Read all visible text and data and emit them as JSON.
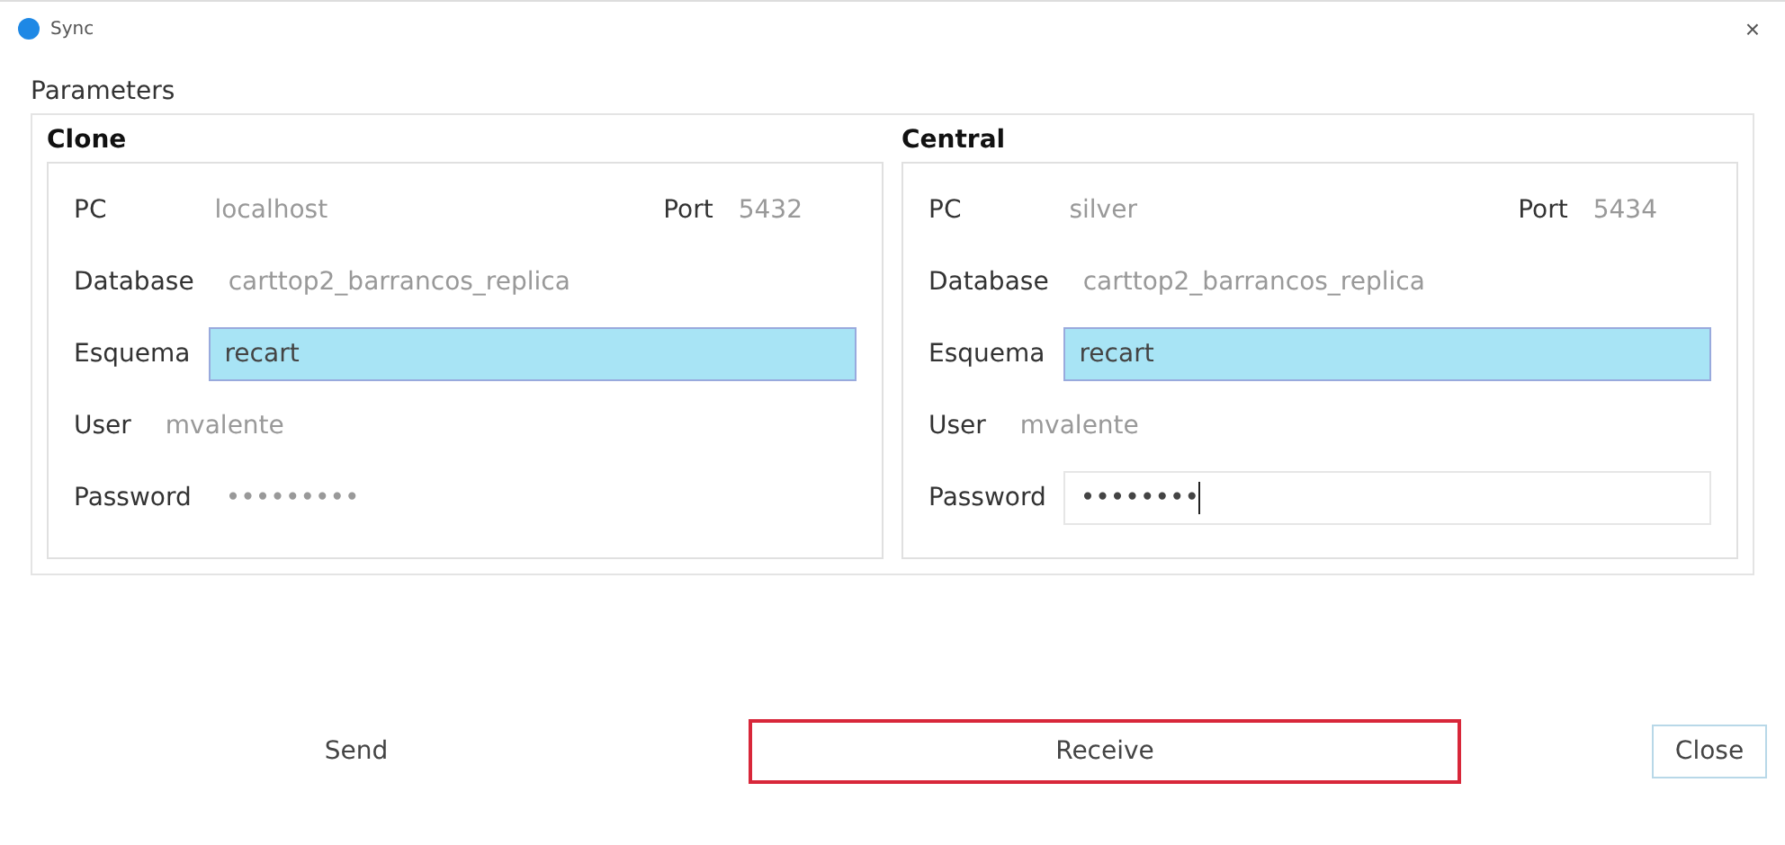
{
  "window": {
    "title": "Sync",
    "close": "×"
  },
  "parameters": {
    "title": "Parameters",
    "groups": [
      {
        "title": "Clone",
        "pc_label": "PC",
        "pc": "localhost",
        "port_label": "Port",
        "port": "5432",
        "fields": [
          {
            "label": "Database",
            "value": "carttop2_barrancos_replica",
            "selected": false,
            "focused": false
          },
          {
            "label": "Esquema",
            "value": "recart",
            "selected": true,
            "focused": false
          },
          {
            "label": "User",
            "value": "mvalente",
            "selected": false,
            "focused": false
          },
          {
            "label": "Password",
            "value": "•••••••••",
            "selected": false,
            "focused": false
          }
        ]
      },
      {
        "title": "Central",
        "pc_label": "PC",
        "pc": "silver",
        "port_label": "Port",
        "port": "5434",
        "fields": [
          {
            "label": "Database",
            "value": "carttop2_barrancos_replica",
            "selected": false,
            "focused": false
          },
          {
            "label": "Esquema",
            "value": "recart",
            "selected": true,
            "focused": false
          },
          {
            "label": "User",
            "value": "mvalente",
            "selected": false,
            "focused": false
          },
          {
            "label": "Password",
            "value": "••••••••",
            "selected": false,
            "focused": true
          }
        ]
      }
    ]
  },
  "buttons": [
    {
      "label": "Send",
      "kind": "flat",
      "focused": false
    },
    {
      "label": "Receive",
      "kind": "flat",
      "focused": true
    },
    {
      "label": "Close",
      "kind": "default",
      "focused": false
    }
  ]
}
